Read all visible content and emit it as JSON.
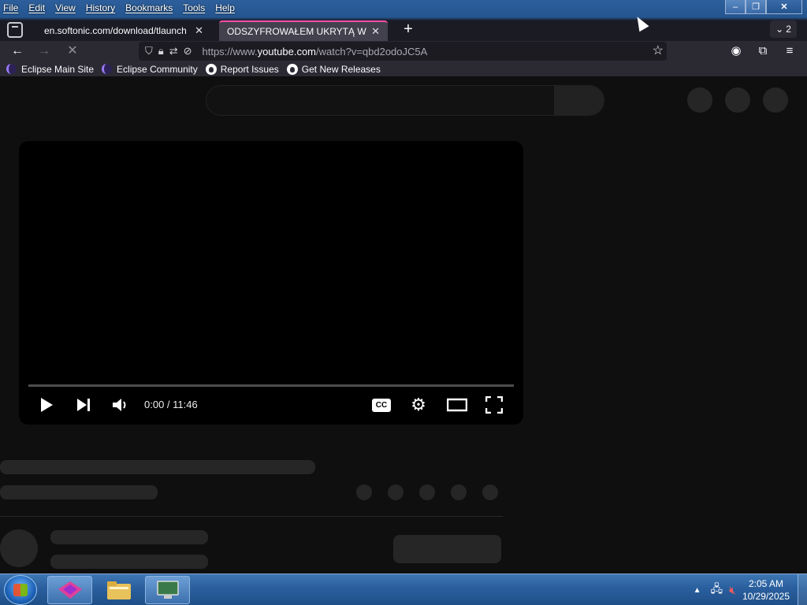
{
  "menubar": {
    "items": [
      "File",
      "Edit",
      "View",
      "History",
      "Bookmarks",
      "Tools",
      "Help"
    ]
  },
  "tabs": [
    {
      "title": "en.softonic.com/download/tlaunch",
      "active": false
    },
    {
      "title": "ODSZYFROWAŁEM UKRYTĄ WIADOMOŚĆ",
      "active": true
    }
  ],
  "tab_count": "2",
  "urlbar": {
    "scheme": "https://www.",
    "host": "youtube.com",
    "path": "/watch?v=qbd2odoJC5A"
  },
  "bookmarks": [
    {
      "label": "Eclipse Main Site",
      "icon": "eclipse-icon"
    },
    {
      "label": "Eclipse Community",
      "icon": "eclipse-icon"
    },
    {
      "label": "Report Issues",
      "icon": "github-icon"
    },
    {
      "label": "Get New Releases",
      "icon": "github-icon"
    }
  ],
  "player": {
    "time": "0:00 / 11:46",
    "cc_label": "CC",
    "progress": 0
  },
  "taskbar": {
    "time": "2:05 AM",
    "date": "10/29/2025"
  },
  "colors": {
    "active_tab_accent": "#ff4fa8",
    "page_bg": "#0f0f0f",
    "skeleton": "#262626"
  }
}
